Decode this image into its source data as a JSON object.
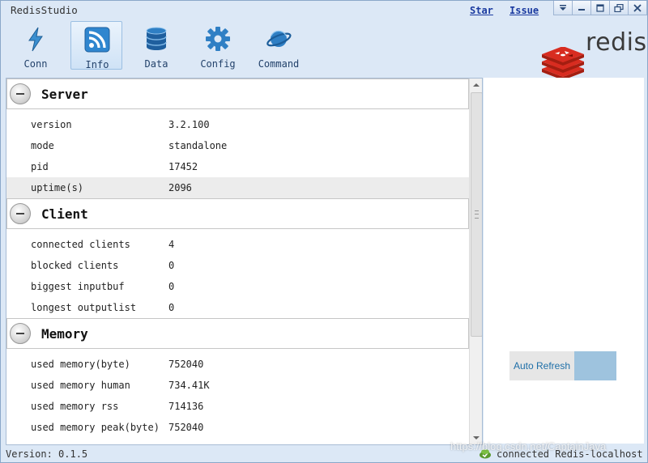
{
  "app": {
    "title": "RedisStudio",
    "links": [
      "Star",
      "Issue"
    ]
  },
  "toolbar": {
    "items": [
      {
        "label": "Conn",
        "icon": "lightning-icon"
      },
      {
        "label": "Info",
        "icon": "rss-icon",
        "active": true
      },
      {
        "label": "Data",
        "icon": "database-icon"
      },
      {
        "label": "Config",
        "icon": "gear-icon"
      },
      {
        "label": "Command",
        "icon": "planet-icon"
      }
    ],
    "logo_text": "redis"
  },
  "sections": [
    {
      "title": "Server",
      "rows": [
        {
          "key": "version",
          "value": "3.2.100"
        },
        {
          "key": "mode",
          "value": "standalone"
        },
        {
          "key": "pid",
          "value": "17452"
        },
        {
          "key": "uptime(s)",
          "value": "2096",
          "highlighted": true
        }
      ]
    },
    {
      "title": "Client",
      "rows": [
        {
          "key": "connected clients",
          "value": "4"
        },
        {
          "key": "blocked clients",
          "value": "0"
        },
        {
          "key": "biggest inputbuf",
          "value": "0"
        },
        {
          "key": "longest outputlist",
          "value": "0"
        }
      ]
    },
    {
      "title": "Memory",
      "rows": [
        {
          "key": "used memory(byte)",
          "value": "752040"
        },
        {
          "key": "used memory human",
          "value": "734.41K"
        },
        {
          "key": "used memory rss",
          "value": "714136"
        },
        {
          "key": "used memory peak(byte)",
          "value": "752040"
        }
      ]
    }
  ],
  "right_panel": {
    "auto_refresh_label": "Auto Refresh"
  },
  "status": {
    "version": "Version: 0.1.5",
    "connection": "connected Redis-localhost"
  },
  "watermark": "https://blog.csdn.net/CaptainJava",
  "colors": {
    "window_bg": "#dce8f6",
    "accent_blue": "#1e6fa8",
    "toggle": "#9ec3de",
    "redis_red": "#c6302b"
  }
}
